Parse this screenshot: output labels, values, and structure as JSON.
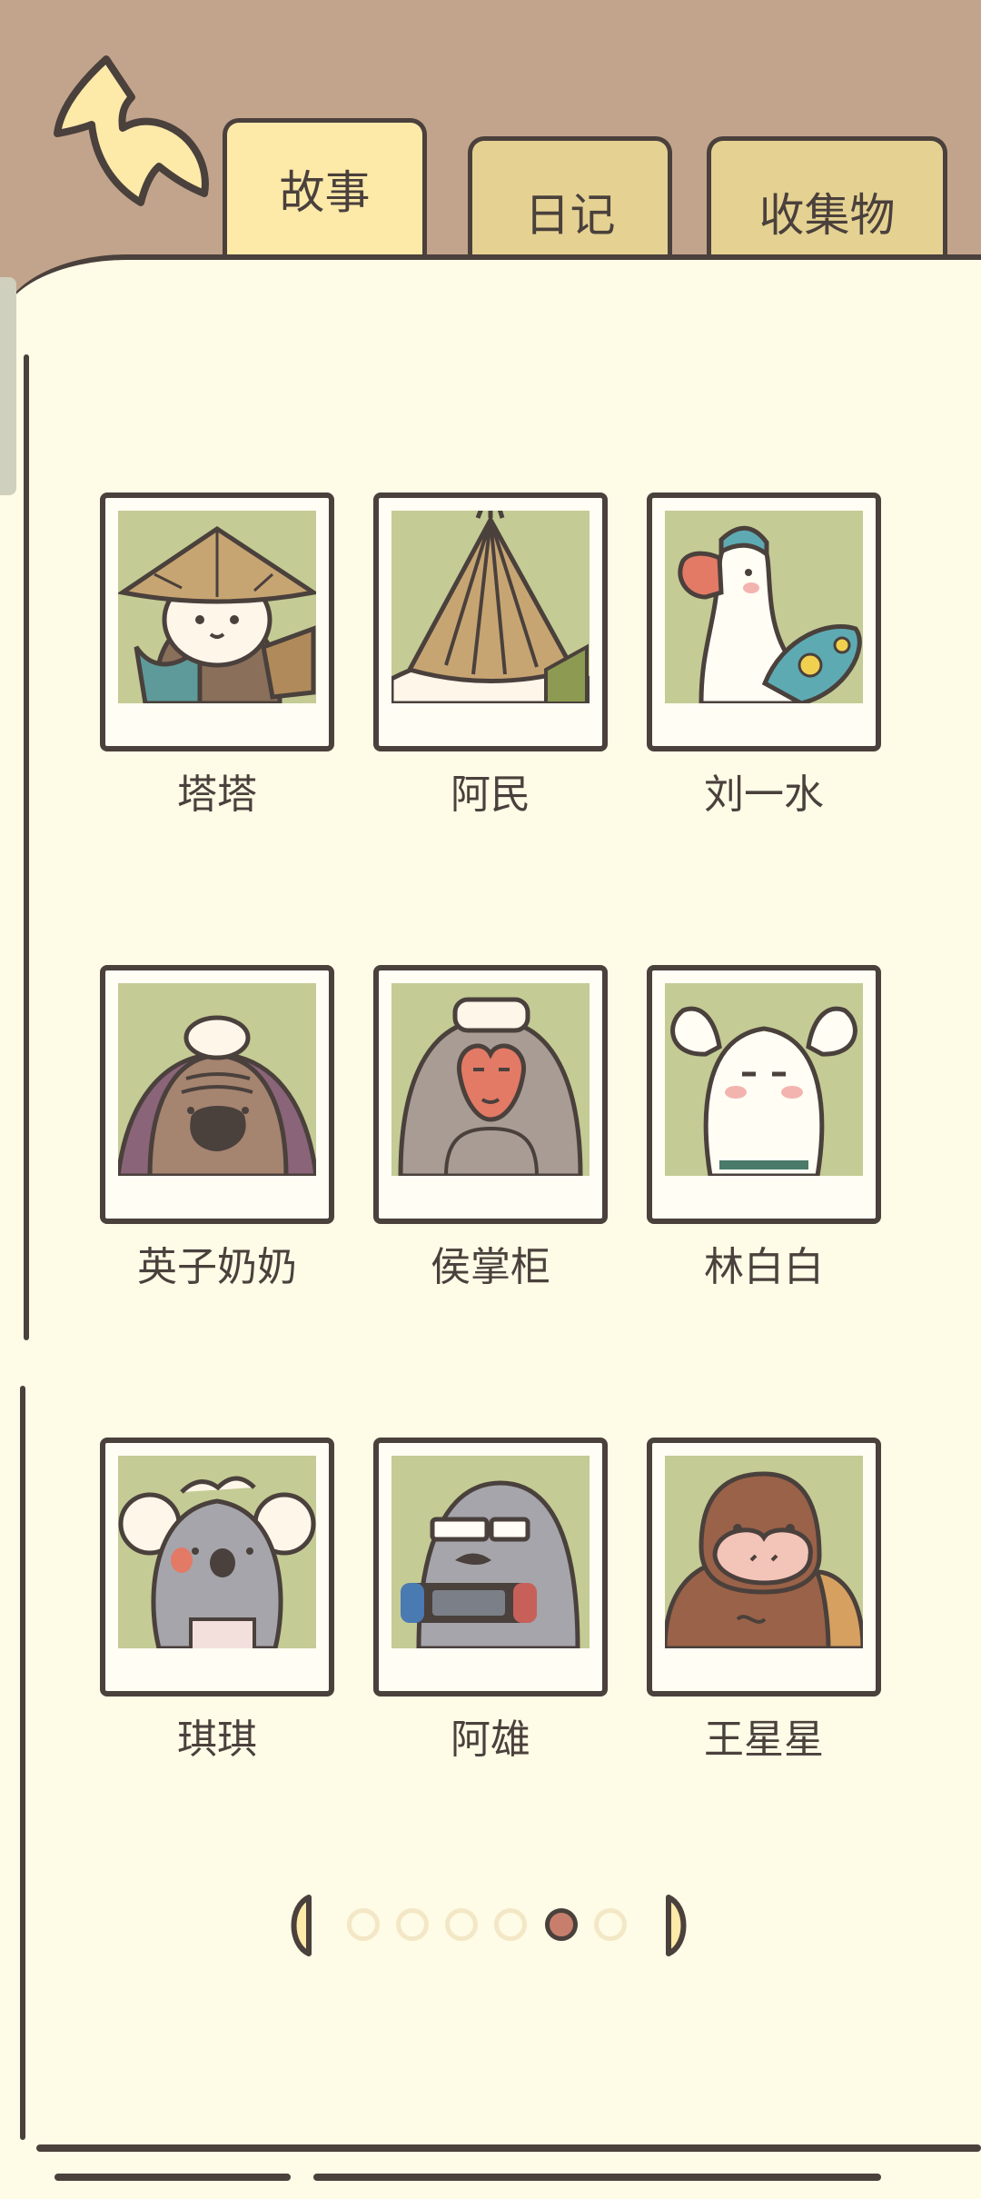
{
  "tabs": [
    {
      "label": "故事",
      "active": true
    },
    {
      "label": "日记",
      "active": false
    },
    {
      "label": "收集物",
      "active": false
    }
  ],
  "characters": [
    {
      "name": "塔塔",
      "icon": "otter-straw-hat-icon"
    },
    {
      "name": "阿民",
      "icon": "hedgehog-straw-hat-icon"
    },
    {
      "name": "刘一水",
      "icon": "duck-surfboard-icon"
    },
    {
      "name": "英子奶奶",
      "icon": "platypus-grandma-icon"
    },
    {
      "name": "侯掌柜",
      "icon": "macaque-icon"
    },
    {
      "name": "林白白",
      "icon": "rabbit-icon"
    },
    {
      "name": "琪琪",
      "icon": "koala-icon"
    },
    {
      "name": "阿雄",
      "icon": "seal-gamer-icon"
    },
    {
      "name": "王星星",
      "icon": "gorilla-icon"
    }
  ],
  "pagination": {
    "total_pages": 6,
    "current_page": 5
  },
  "colors": {
    "header_bg": "#c2a48c",
    "page_bg": "#fefbe6",
    "outline": "#4a403c",
    "portrait_bg": "#c4cb94",
    "active_tab": "#fde9a8",
    "inactive_tab": "#e5d292",
    "active_dot": "#c87e6c"
  }
}
